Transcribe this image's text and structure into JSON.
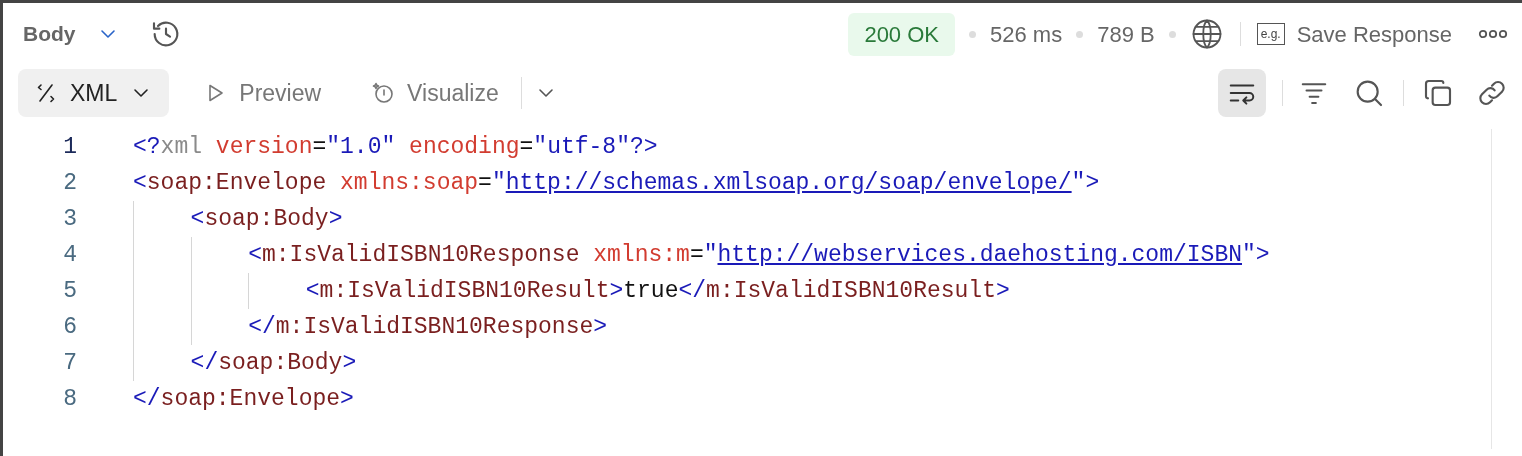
{
  "header": {
    "section": "Body",
    "status": "200 OK",
    "time": "526 ms",
    "size": "789 B",
    "save_icon_text": "e.g.",
    "save_label": "Save Response"
  },
  "view_modes": [
    {
      "kind": "format",
      "label": "XML",
      "selected": true
    },
    {
      "kind": "preview",
      "label": "Preview",
      "selected": false
    },
    {
      "kind": "visualize",
      "label": "Visualize",
      "selected": false
    }
  ],
  "tools": {
    "wrap_selected": true
  },
  "code": {
    "lines": [
      {
        "number": "1",
        "active": true,
        "tokens": [
          {
            "kind": "punct",
            "text": "<?"
          },
          {
            "kind": "decl",
            "text": "xml"
          },
          {
            "kind": "attr",
            "text": " version"
          },
          {
            "kind": "text",
            "text": "="
          },
          {
            "kind": "value",
            "text": "\"1.0\""
          },
          {
            "kind": "attr",
            "text": " encoding"
          },
          {
            "kind": "text",
            "text": "="
          },
          {
            "kind": "value",
            "text": "\"utf-8\"?>"
          }
        ]
      },
      {
        "number": "2",
        "active": false,
        "tokens": [
          {
            "kind": "punct",
            "text": "<"
          },
          {
            "kind": "tag",
            "text": "soap:Envelope"
          },
          {
            "kind": "attr",
            "text": " xmlns:soap"
          },
          {
            "kind": "text",
            "text": "="
          },
          {
            "kind": "value",
            "text": "\""
          },
          {
            "kind": "url",
            "text": "http://schemas.xmlsoap.org/soap/envelope/"
          },
          {
            "kind": "value",
            "text": "\">"
          }
        ],
        "children": [
          {
            "number": "3",
            "active": false,
            "tokens": [
              {
                "kind": "punct",
                "text": "<"
              },
              {
                "kind": "tag",
                "text": "soap:Body"
              },
              {
                "kind": "punct",
                "text": ">"
              }
            ],
            "children": [
              {
                "number": "4",
                "active": false,
                "tokens": [
                  {
                    "kind": "punct",
                    "text": "<"
                  },
                  {
                    "kind": "tag",
                    "text": "m:IsValidISBN10Response"
                  },
                  {
                    "kind": "attr",
                    "text": " xmlns:m"
                  },
                  {
                    "kind": "text",
                    "text": "="
                  },
                  {
                    "kind": "value",
                    "text": "\""
                  },
                  {
                    "kind": "url",
                    "text": "http://webservices.daehosting.com/ISBN"
                  },
                  {
                    "kind": "value",
                    "text": "\">"
                  }
                ],
                "children": [
                  {
                    "number": "5",
                    "active": false,
                    "tokens": [
                      {
                        "kind": "punct",
                        "text": "<"
                      },
                      {
                        "kind": "tag",
                        "text": "m:IsValidISBN10Result"
                      },
                      {
                        "kind": "punct",
                        "text": ">"
                      },
                      {
                        "kind": "text",
                        "text": "true"
                      },
                      {
                        "kind": "punct",
                        "text": "</"
                      },
                      {
                        "kind": "tag",
                        "text": "m:IsValidISBN10Result"
                      },
                      {
                        "kind": "punct",
                        "text": ">"
                      }
                    ]
                  }
                ]
              },
              {
                "number": "6",
                "active": false,
                "tokens": [
                  {
                    "kind": "punct",
                    "text": "</"
                  },
                  {
                    "kind": "tag",
                    "text": "m:IsValidISBN10Response"
                  },
                  {
                    "kind": "punct",
                    "text": ">"
                  }
                ]
              }
            ]
          },
          {
            "number": "7",
            "active": false,
            "tokens": [
              {
                "kind": "punct",
                "text": "</"
              },
              {
                "kind": "tag",
                "text": "soap:Body"
              },
              {
                "kind": "punct",
                "text": ">"
              }
            ]
          }
        ]
      },
      {
        "number": "8",
        "active": false,
        "tokens": [
          {
            "kind": "punct",
            "text": "</"
          },
          {
            "kind": "tag",
            "text": "soap:Envelope"
          },
          {
            "kind": "punct",
            "text": ">"
          }
        ]
      }
    ]
  }
}
